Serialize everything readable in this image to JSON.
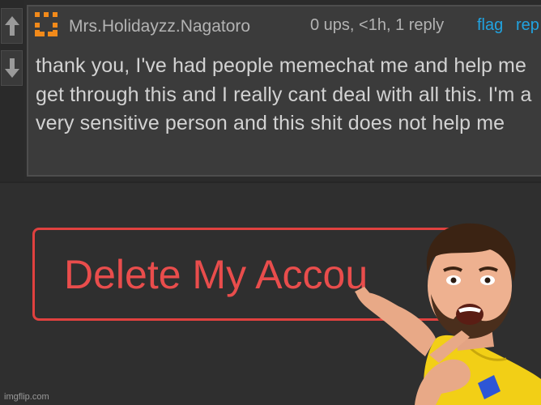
{
  "comment": {
    "username": "Mrs.Holidayzz.Nagatoro",
    "meta": "0 ups, <1h, 1 reply",
    "flag_label": "flag",
    "reply_label": "rep",
    "text": "thank you, I've had people memechat me and help me get through this and I really cant deal with all this. I'm a very sensitive person and this shit does not help me"
  },
  "voting": {
    "upvote_icon": "arrow-up-icon",
    "downvote_icon": "arrow-down-icon"
  },
  "account_action": {
    "label": "Delete My Accou"
  },
  "watermark": "imgflip.com",
  "colors": {
    "link": "#21a3e0",
    "danger": "#e0413f",
    "avatar_orange": "#f28a1a",
    "background": "#2f2f2f"
  }
}
